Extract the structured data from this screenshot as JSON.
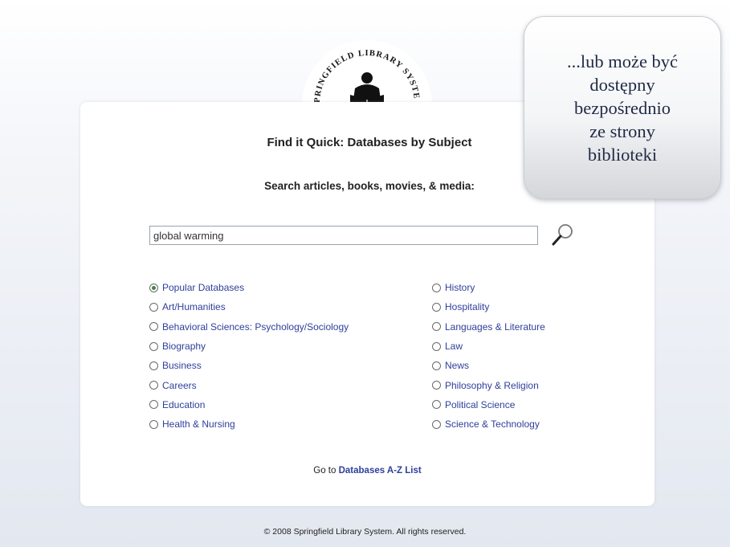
{
  "logo": {
    "text": "SPRINGFIELD LIBRARY SYSTEM"
  },
  "page": {
    "title": "Find it Quick: Databases by Subject",
    "subtitle": "Search articles, books, movies, & media:"
  },
  "search": {
    "value": "global warming"
  },
  "subjects_left": [
    {
      "label": "Popular Databases",
      "checked": true
    },
    {
      "label": "Art/Humanities",
      "checked": false
    },
    {
      "label": "Behavioral Sciences: Psychology/Sociology",
      "checked": false
    },
    {
      "label": "Biography",
      "checked": false
    },
    {
      "label": "Business",
      "checked": false
    },
    {
      "label": "Careers",
      "checked": false
    },
    {
      "label": "Education",
      "checked": false
    },
    {
      "label": "Health & Nursing",
      "checked": false
    }
  ],
  "subjects_right": [
    {
      "label": "History",
      "checked": false
    },
    {
      "label": "Hospitality",
      "checked": false
    },
    {
      "label": "Languages & Literature",
      "checked": false
    },
    {
      "label": "Law",
      "checked": false
    },
    {
      "label": "News",
      "checked": false
    },
    {
      "label": "Philosophy & Religion",
      "checked": false
    },
    {
      "label": "Political Science",
      "checked": false
    },
    {
      "label": "Science & Technology",
      "checked": false
    }
  ],
  "goto": {
    "prefix": "Go to",
    "link": "Databases A-Z List"
  },
  "footer": {
    "text": "© 2008 Springfield Library System. All rights reserved."
  },
  "callout": {
    "text": "...lub może być\ndostępny\nbezpośrednio\nze strony\nbiblioteki"
  },
  "colors": {
    "link": "#2f3f9a",
    "radio_checked": "#3a8a3a"
  }
}
